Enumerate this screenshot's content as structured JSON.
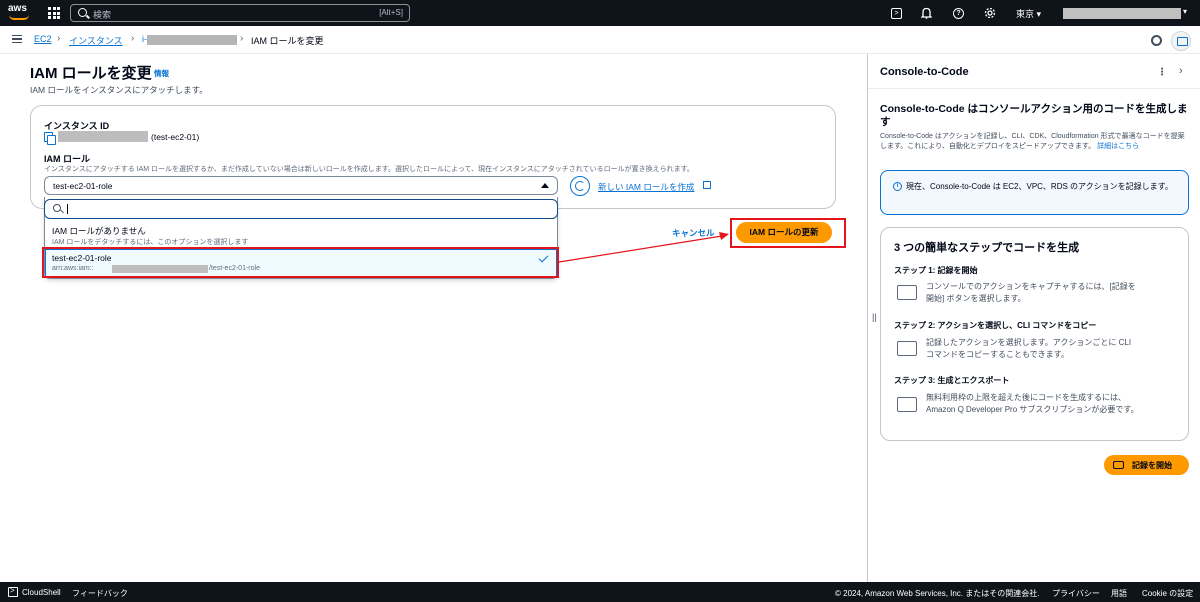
{
  "topnav": {
    "logo_text": "aws",
    "search_placeholder": "検索",
    "search_shortcut": "[Alt+S]",
    "region": "東京 ▾"
  },
  "breadcrumb": {
    "items": [
      "EC2",
      "インスタンス",
      "i-",
      "IAM ロールを変更"
    ]
  },
  "main": {
    "title": "IAM ロールを変更",
    "info_link": "情報",
    "description": "IAM ロールをインスタンスにアタッチします。",
    "instance_id_label": "インスタンス ID",
    "instance_name": "(test-ec2-01)",
    "iam_role_label": "IAM ロール",
    "iam_role_description": "インスタンスにアタッチする IAM ロールを選択するか、まだ作成していない場合は新しいロールを作成します。選択したロールによって、現在インスタンスにアタッチされているロールが置き換えられます。",
    "selected_role": "test-ec2-01-role",
    "create_role_link": "新しい IAM ロールを作成",
    "filter_value": "",
    "options": [
      {
        "title": "IAM ロールがありません",
        "description": "IAM ロールをデタッチするには、このオプションを選択します"
      },
      {
        "title": "test-ec2-01-role",
        "arn_prefix": "arn:aws:iam::",
        "arn_suffix": "/test-ec2-01-role"
      }
    ],
    "cancel_label": "キャンセル",
    "update_label": "IAM ロールの更新"
  },
  "panel": {
    "title": "Console-to-Code",
    "heading": "Console-to-Code はコンソールアクション用のコードを生成します",
    "description": "Console-to-Code はアクションを記録し、CLI、CDK、Cloudformation 形式で最適なコードを提案します。これにより、自動化とデプロイをスピードアップできます。",
    "learn_more": "詳細はこちら",
    "info_text": "現在、Console-to-Code は EC2、VPC、RDS のアクションを記録します。",
    "steps_title": "3 つの簡単なステップでコードを生成",
    "steps": [
      {
        "heading": "ステップ 1: 記録を開始",
        "text": "コンソールでのアクションをキャプチャするには、[記録を開始] ボタンを選択します。"
      },
      {
        "heading": "ステップ 2: アクションを選択し、CLI コマンドをコピー",
        "text": "記録したアクションを選択します。アクションごとに CLI コマンドをコピーすることもできます。"
      },
      {
        "heading": "ステップ 3: 生成とエクスポート",
        "text": "無料利用枠の上限を超えた後にコードを生成するには、Amazon Q Developer Pro サブスクリプションが必要です。"
      }
    ],
    "record_button": "記録を開始"
  },
  "footer": {
    "cloudshell": "CloudShell",
    "feedback": "フィードバック",
    "copyright": "© 2024, Amazon Web Services, Inc. またはその関連会社.",
    "privacy": "プライバシー",
    "terms": "用語",
    "cookie": "Cookie の設定"
  },
  "colors": {
    "accent": "#0972d3",
    "primary_button": "#ff9900",
    "highlight": "#e4141b",
    "nav_bg": "#0f141a"
  }
}
